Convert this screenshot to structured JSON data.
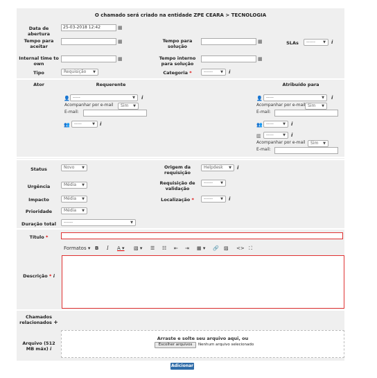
{
  "header": {
    "title": "O chamado será criado na entidade ZPE CEARA > TECNOLOGIA"
  },
  "fields": {
    "data_abertura": {
      "label": "Data de abertura",
      "value": "25-03-2018 12:42"
    },
    "tempo_aceitar": {
      "label": "Tempo para aceitar"
    },
    "tempo_solucao": {
      "label": "Tempo para solução"
    },
    "slas": {
      "label": "SLAs",
      "value": "------"
    },
    "internal_time": {
      "label": "Internal time to own"
    },
    "tempo_interno": {
      "label": "Tempo interno para solução"
    },
    "tipo": {
      "label": "Tipo",
      "value": "Requisição"
    },
    "categoria": {
      "label": "Categoria",
      "value": "------"
    }
  },
  "actor": {
    "label": "Ator",
    "requerente": {
      "label": "Requerente",
      "user_value": "-----",
      "follow_label": "Acompanhar por e-mail",
      "follow_value": "Sim",
      "email_label": "E-mail:",
      "group_value": "-----"
    },
    "atribuido": {
      "label": "Atribuído para",
      "user_value": "-----",
      "follow_label": "Acompanhar por e-mail",
      "follow_value": "Sim",
      "email_label": "E-mail:",
      "group_value": "-----",
      "supplier_value": "-----",
      "follow2_label": "Acompanhar por e-mail",
      "follow2_value": "Sim",
      "email2_label": "E-mail:"
    }
  },
  "status": {
    "status": {
      "label": "Status",
      "value": "Novo"
    },
    "origem": {
      "label": "Origem da requisição",
      "value": "Helpdesk"
    },
    "urgencia": {
      "label": "Urgência",
      "value": "Média"
    },
    "req_validacao": {
      "label": "Requisição de validação",
      "value": "------"
    },
    "impacto": {
      "label": "Impacto",
      "value": "Média"
    },
    "localizacao": {
      "label": "Localização",
      "value": "------"
    },
    "prioridade": {
      "label": "Prioridade",
      "value": "Média"
    },
    "duracao": {
      "label": "Duração total",
      "value": "------"
    }
  },
  "content": {
    "titulo_label": "Título",
    "descricao_label": "Descrição",
    "toolbar": {
      "formatos": "Formatos"
    },
    "chamados_label": "Chamados relacionados",
    "arquivo_label": "Arquivo (512 MB máx)",
    "drop_text": "Arraste e solte seu arquivo aqui, ou",
    "choose_button": "Escolher arquivos",
    "no_file": "Nenhum arquivo selecionado"
  },
  "submit_label": "Adicionar",
  "colors": {
    "submit": "#2f6ca8",
    "required": "#dd0000",
    "panel": "#efefef"
  }
}
